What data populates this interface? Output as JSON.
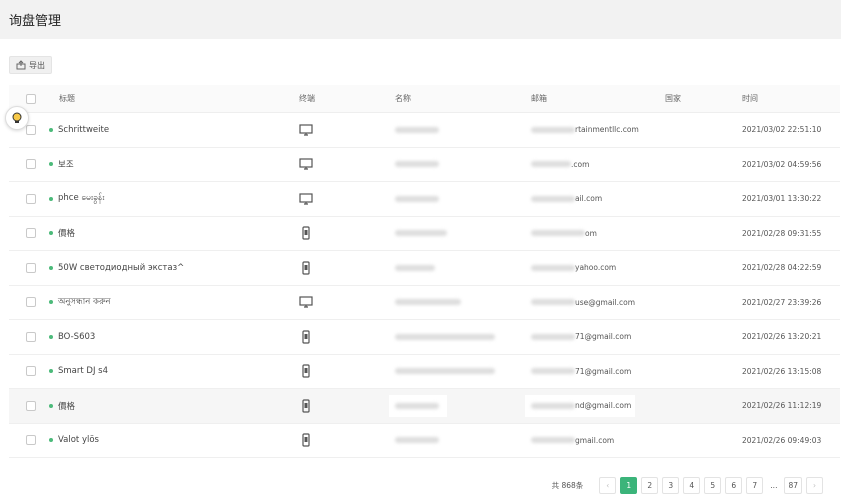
{
  "header": {
    "title": "询盘管理"
  },
  "toolbar": {
    "export_label": "导出"
  },
  "table": {
    "columns": [
      "标题",
      "终端",
      "名称",
      "邮箱",
      "国家",
      "时间"
    ],
    "rows": [
      {
        "title": "Schrittweite",
        "terminal": "desktop",
        "email_suffix": "rtainmentllc.com",
        "country": "",
        "time": "2021/03/02 22:51:10"
      },
      {
        "title": "보조",
        "terminal": "desktop",
        "email_suffix": ".com",
        "country": "",
        "time": "2021/03/02 04:59:56"
      },
      {
        "title": "phce မေးခွန်း",
        "terminal": "desktop",
        "email_suffix": "ail.com",
        "country": "",
        "time": "2021/03/01 13:30:22"
      },
      {
        "title": "價格",
        "terminal": "mobile",
        "email_suffix": "om",
        "country": "",
        "time": "2021/02/28 09:31:55"
      },
      {
        "title": "50W светодиодный экстаз^",
        "terminal": "mobile",
        "email_suffix": "yahoo.com",
        "country": "",
        "time": "2021/02/28 04:22:59"
      },
      {
        "title": "অনুসন্ধান করুন",
        "terminal": "desktop",
        "email_suffix": "use@gmail.com",
        "country": "",
        "time": "2021/02/27 23:39:26"
      },
      {
        "title": "BO-S603",
        "terminal": "mobile",
        "email_suffix": "71@gmail.com",
        "country": "",
        "time": "2021/02/26 13:20:21"
      },
      {
        "title": "Smart DJ s4",
        "terminal": "mobile",
        "email_suffix": "71@gmail.com",
        "country": "",
        "time": "2021/02/26 13:15:08"
      },
      {
        "title": "價格",
        "terminal": "mobile",
        "email_suffix": "nd@gmail.com",
        "country": "",
        "time": "2021/02/26 11:12:19"
      },
      {
        "title": "Valot ylös",
        "terminal": "mobile",
        "email_suffix": "gmail.com",
        "country": "",
        "time": "2021/02/26 09:49:03"
      }
    ]
  },
  "pagination": {
    "total": "共 868条",
    "pages": [
      "1",
      "2",
      "3",
      "4",
      "5",
      "6",
      "7",
      "...",
      "87"
    ],
    "current": "1",
    "prev": "‹",
    "next": "›"
  },
  "colors": {
    "accent": "#3bb47a",
    "status_dot": "#4cba7a"
  }
}
